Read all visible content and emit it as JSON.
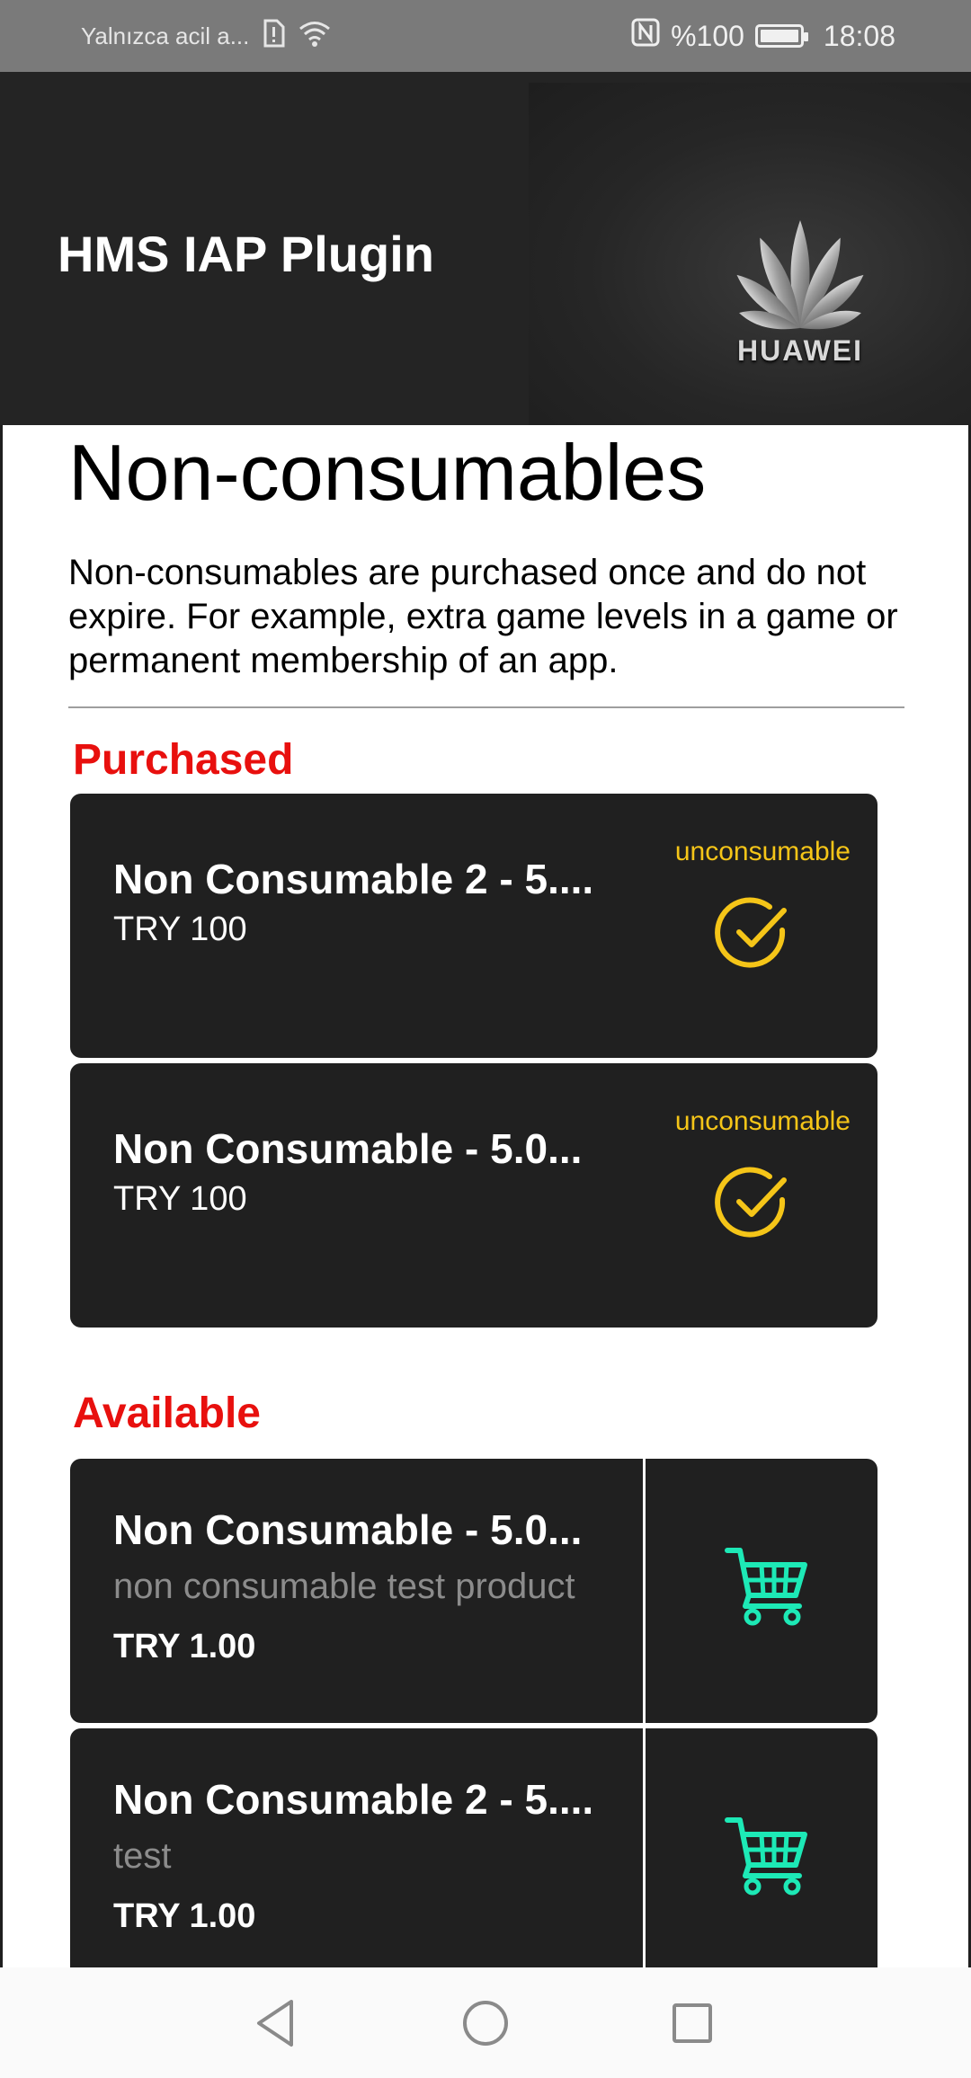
{
  "status_bar": {
    "carrier_text": "Yalnızca acil a...",
    "battery_text": "%100",
    "battery_level": 1.0,
    "time": "18:08",
    "icons": [
      "sim-alert-icon",
      "wifi-icon",
      "nfc-icon",
      "battery-icon"
    ]
  },
  "header": {
    "title": "HMS IAP Plugin",
    "logo_text": "HUAWEI"
  },
  "page": {
    "title": "Non-consumables",
    "description": "Non-consumables are purchased once and do not expire. For example, extra game levels in a game or permanent membership of an app."
  },
  "purchased": {
    "label": "Purchased",
    "items": [
      {
        "title": "Non Consumable 2 - 5....",
        "price": "TRY 100",
        "tag": "unconsumable",
        "icon": "check-circle-icon"
      },
      {
        "title": "Non Consumable - 5.0...",
        "price": "TRY 100",
        "tag": "unconsumable",
        "icon": "check-circle-icon"
      }
    ]
  },
  "available": {
    "label": "Available",
    "items": [
      {
        "title": "Non Consumable - 5.0...",
        "description": "non consumable test product",
        "price": "TRY 1.00",
        "icon": "shopping-cart-icon"
      },
      {
        "title": "Non Consumable 2 - 5....",
        "description": "test",
        "price": "TRY 1.00",
        "icon": "shopping-cart-icon"
      }
    ]
  },
  "colors": {
    "accent_red": "#e8100e",
    "tag_yellow": "#f5c518",
    "cart_green": "#1de9b6",
    "card_bg": "#202020"
  },
  "nav_bar": {
    "buttons": [
      "back-icon",
      "home-icon",
      "recents-icon"
    ]
  }
}
